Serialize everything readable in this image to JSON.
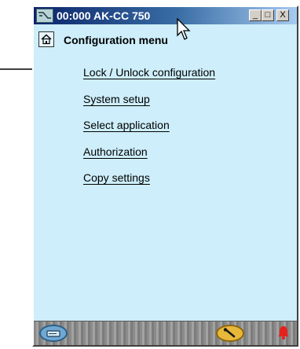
{
  "window": {
    "title": "00:000 AK-CC 750",
    "buttons": {
      "minimize": "_",
      "maximize": "□",
      "close": "X"
    }
  },
  "header": {
    "title": "Configuration menu"
  },
  "menu": {
    "items": [
      {
        "label": "Lock / Unlock configuration"
      },
      {
        "label": "System setup"
      },
      {
        "label": "Select application"
      },
      {
        "label": "Authorization"
      },
      {
        "label": "Copy settings"
      }
    ]
  },
  "icons": {
    "app": "device-icon",
    "home": "home-icon",
    "footer_left": "display-icon",
    "footer_right": "wrench-icon",
    "alarm": "bell-icon",
    "cursor": "mouse-pointer-icon",
    "annotation": "arrow-icon"
  },
  "colors": {
    "window_background": "#cdeefa",
    "titlebar_start": "#0a246a",
    "titlebar_end": "#a6caf0",
    "alarm": "#e8201c"
  }
}
